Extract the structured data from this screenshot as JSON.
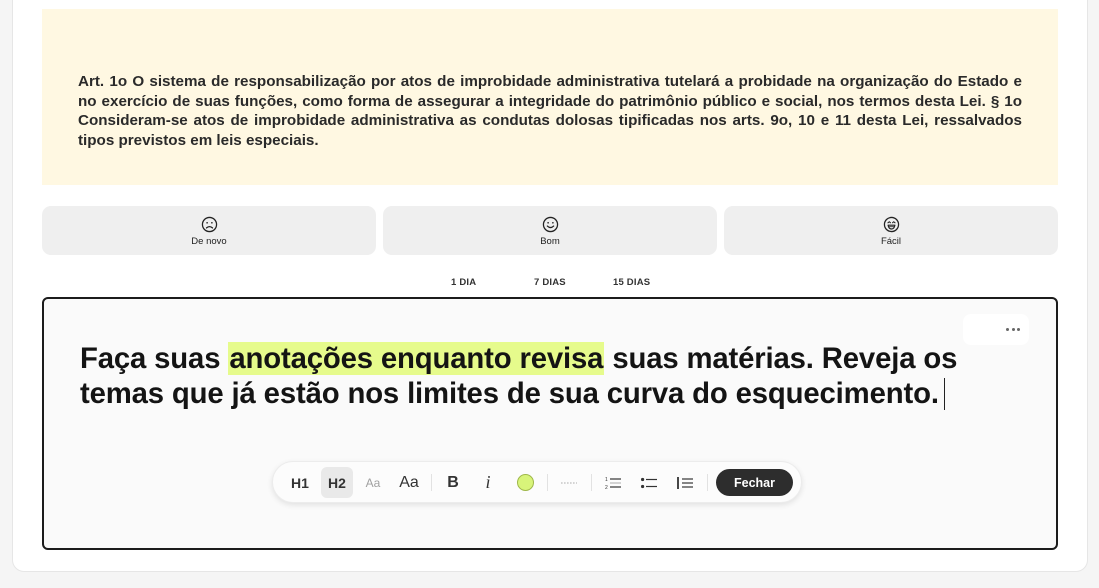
{
  "article": {
    "text": "Art. 1o O sistema de responsabilização por atos de improbidade administrativa tutelará a probidade na organização do Estado e no exercício de suas funções, como forma de assegurar a integridade do patrimônio público e social, nos termos desta Lei. § 1o Consideram-se atos de improbidade administrativa as condutas dolosas tipificadas nos arts. 9o, 10 e 11 desta Lei, ressalvados tipos previstos em leis especiais."
  },
  "ratings": [
    {
      "label": "De novo",
      "icon": "sad-face-icon"
    },
    {
      "label": "Bom",
      "icon": "smile-face-icon"
    },
    {
      "label": "Fácil",
      "icon": "grin-face-icon"
    }
  ],
  "intervals": [
    "1 DIA",
    "7 DIAS",
    "15 DIAS"
  ],
  "editor": {
    "before": "Faça suas ",
    "highlight": "anotações enquanto revisa",
    "after": " suas matérias. Reveja os temas que já estão nos limites de sua curva do esquecimento.",
    "highlight_color": "#e6fb8c"
  },
  "toolbar": {
    "h1": "H1",
    "h2": "H2",
    "aa_small": "Aa",
    "aa_large": "Aa",
    "bold": "B",
    "italic": "i",
    "highlight_color": "#d8f47a",
    "close_label": "Fechar",
    "selected": "H2"
  }
}
